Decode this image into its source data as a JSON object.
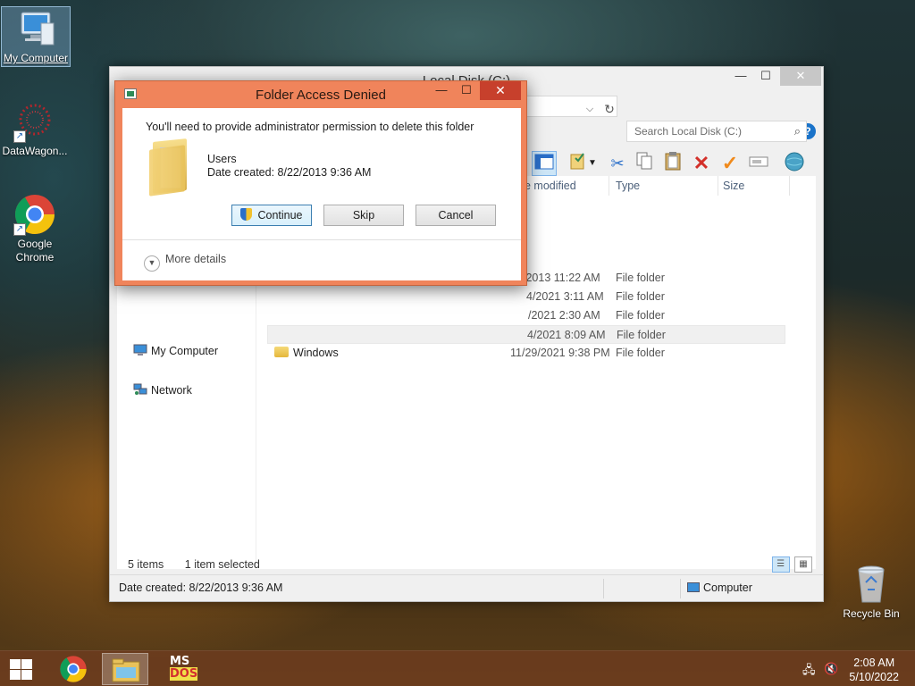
{
  "desktop": {
    "icons": [
      {
        "label": "My Computer"
      },
      {
        "label": "DataWagon..."
      },
      {
        "label": "Google Chrome"
      },
      {
        "label": "Recycle Bin"
      }
    ]
  },
  "explorer": {
    "title": "Local Disk (C:)",
    "search_placeholder": "Search Local Disk (C:)",
    "help_label": "?",
    "columns": [
      "e modified",
      "Type",
      "Size"
    ],
    "nav": [
      {
        "label": "My Computer"
      },
      {
        "label": "Network"
      }
    ],
    "rows": [
      {
        "name": "",
        "date": "/2013 11:22 AM",
        "type": "File folder"
      },
      {
        "name": "",
        "date": "4/2021 3:11 AM",
        "type": "File folder"
      },
      {
        "name": "",
        "date": "/2021 2:30 AM",
        "type": "File folder"
      },
      {
        "name": "",
        "date": "4/2021 8:09 AM",
        "type": "File folder"
      },
      {
        "name": "Windows",
        "date": "11/29/2021 9:38 PM",
        "type": "File folder"
      }
    ],
    "status_items": "5 items",
    "status_selected": "1 item selected",
    "details_left": "Date created: 8/22/2013 9:36 AM",
    "details_right": "Computer"
  },
  "dialog": {
    "title": "Folder Access Denied",
    "message": "You'll need to provide administrator permission to delete this folder",
    "folder_name": "Users",
    "folder_date": "Date created: 8/22/2013 9:36 AM",
    "buttons": {
      "continue": "Continue",
      "skip": "Skip",
      "cancel": "Cancel"
    },
    "more_details": "More details"
  },
  "taskbar": {
    "time": "2:08 AM",
    "date": "5/10/2022",
    "msdos_label_top": "MS",
    "msdos_label_bottom": "DOS"
  }
}
